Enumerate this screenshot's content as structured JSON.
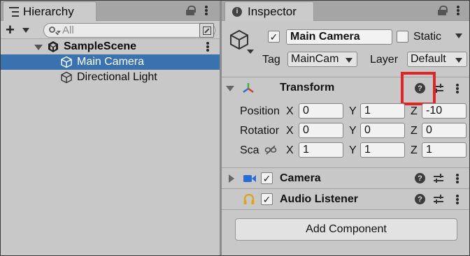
{
  "hierarchy": {
    "tab_label": "Hierarchy",
    "search_placeholder": "All",
    "scene_name": "SampleScene",
    "items": [
      {
        "label": "Main Camera",
        "selected": true
      },
      {
        "label": "Directional Light",
        "selected": false
      }
    ]
  },
  "inspector": {
    "tab_label": "Inspector",
    "object_name": "Main Camera",
    "static_label": "Static",
    "tag_label": "Tag",
    "tag_value": "MainCam",
    "layer_label": "Layer",
    "layer_value": "Default",
    "transform": {
      "title": "Transform",
      "position_label": "Position",
      "rotation_label": "Rotatior",
      "scale_label": "Sca",
      "position": {
        "x": "0",
        "y": "1",
        "z": "-10"
      },
      "rotation": {
        "x": "0",
        "y": "0",
        "z": "0"
      },
      "scale": {
        "x": "1",
        "y": "1",
        "z": "1"
      },
      "axis_x": "X",
      "axis_y": "Y",
      "axis_z": "Z"
    },
    "components": [
      {
        "title": "Camera",
        "enabled": true
      },
      {
        "title": "Audio Listener",
        "enabled": true
      }
    ],
    "add_component_label": "Add Component",
    "help_glyph": "?",
    "info_glyph": "i",
    "checkmark_glyph": "✓"
  },
  "colors": {
    "selection": "#3a72b0",
    "highlight_box": "#e32424",
    "panel_bg": "#c8c8c8"
  }
}
